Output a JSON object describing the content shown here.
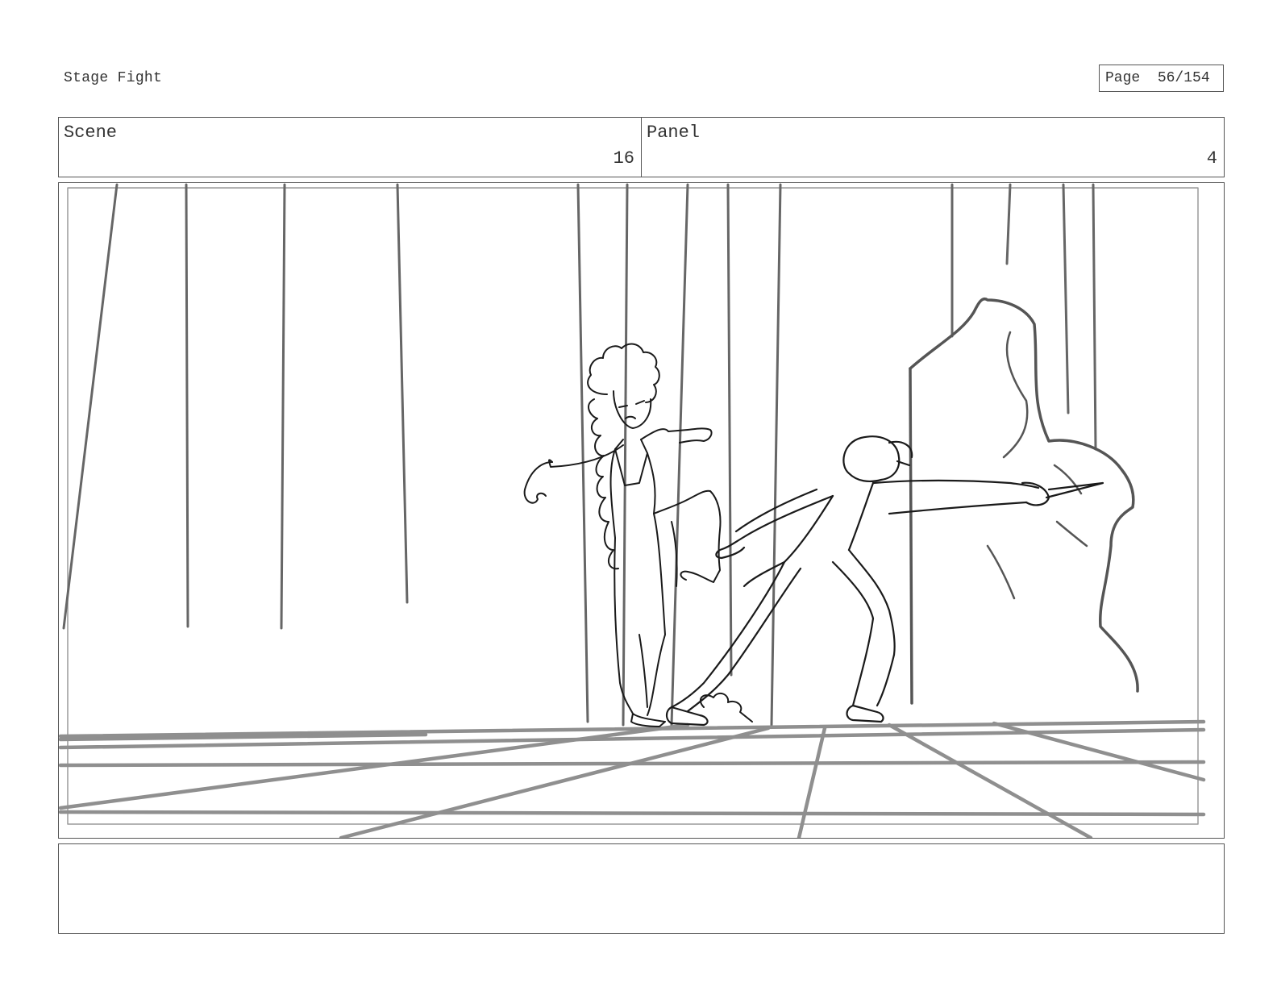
{
  "document": {
    "title": "Stage Fight",
    "page_label": "Page",
    "page_number": "56/154"
  },
  "header": {
    "scene_label": "Scene",
    "scene_number": "16",
    "panel_label": "Panel",
    "panel_number": "4"
  },
  "panel": {
    "drawing": "pencil-sketch-stage-fight-kick-and-lunge",
    "colors": {
      "curtain": "#666666",
      "floor": "#8f8f8f",
      "figure": "#1a1a1a"
    }
  },
  "notes": {
    "text": ""
  }
}
